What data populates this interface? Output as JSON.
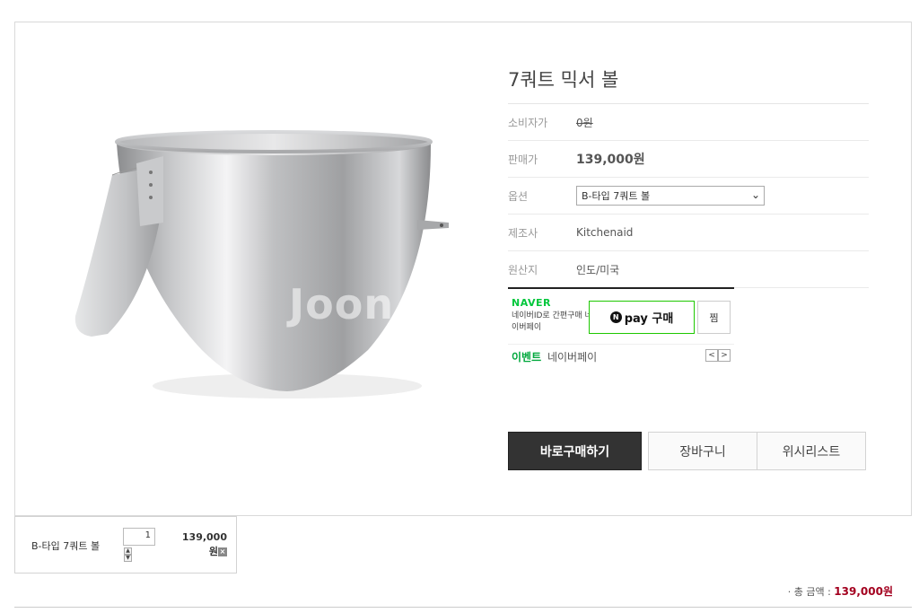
{
  "product": {
    "title": "7쿼트 믹서 볼",
    "watermark": "Joon",
    "rows": [
      {
        "label": "소비자가",
        "value": "0원"
      },
      {
        "label": "판매가",
        "value": "139,000원"
      },
      {
        "label": "옵션",
        "value": "B-타입 7쿼트 볼"
      },
      {
        "label": "제조사",
        "value": "Kitchenaid"
      },
      {
        "label": "원산지",
        "value": "인도/미국"
      }
    ]
  },
  "npay": {
    "brand": "NAVER",
    "desc": "네이버ID로 간편구매 네이버페이",
    "pay_n": "N",
    "pay_label": "pay 구매",
    "zzim": "찜",
    "event": "이벤트",
    "event_text": "네이버페이",
    "prev": "<",
    "next": ">"
  },
  "buttons": {
    "buy": "바로구매하기",
    "cart": "장바구니",
    "wish": "위시리스트"
  },
  "selected": {
    "name": "B-타입 7쿼트 볼",
    "qty": "1",
    "price": "139,000",
    "unit": "원",
    "delete": "×"
  },
  "total": {
    "label": "· 총 금액 :",
    "value": "139,000원"
  }
}
